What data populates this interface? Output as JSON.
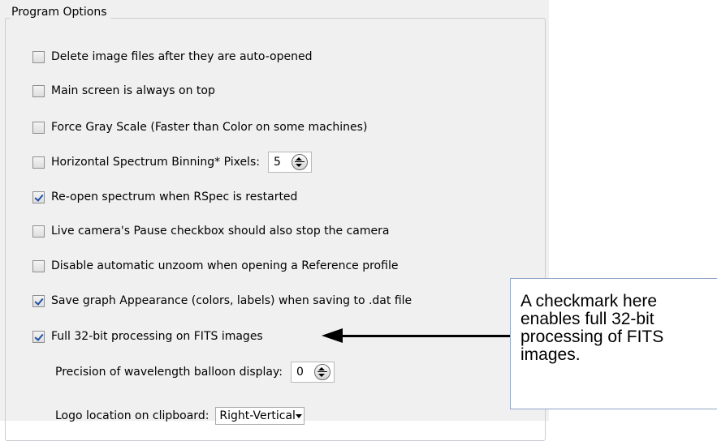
{
  "group": {
    "title": "Program Options"
  },
  "options": [
    {
      "label": "Delete image files after they are auto-opened",
      "checked": false
    },
    {
      "label": "Main screen is always on top",
      "checked": false
    },
    {
      "label": "Force Gray Scale  (Faster than Color on some machines)",
      "checked": false
    },
    {
      "label": "Horizontal Spectrum Binning*  Pixels:",
      "checked": false
    },
    {
      "label": "Re-open spectrum when RSpec is restarted",
      "checked": true
    },
    {
      "label": "Live camera's Pause checkbox should also stop the camera",
      "checked": false
    },
    {
      "label": "Disable automatic unzoom when opening a Reference profile",
      "checked": false
    },
    {
      "label": "Save graph Appearance (colors, labels) when saving to .dat file",
      "checked": true
    },
    {
      "label": "Full 32-bit processing on FITS images",
      "checked": true
    }
  ],
  "binning": {
    "value": "5"
  },
  "precision": {
    "label": "Precision of wavelength balloon display:",
    "value": "0"
  },
  "logo": {
    "label": "Logo location on clipboard:",
    "value": "Right-Vertical"
  },
  "callout": {
    "text": "A checkmark here\nenables full 32-bit\nprocessing of FITS\nimages."
  }
}
